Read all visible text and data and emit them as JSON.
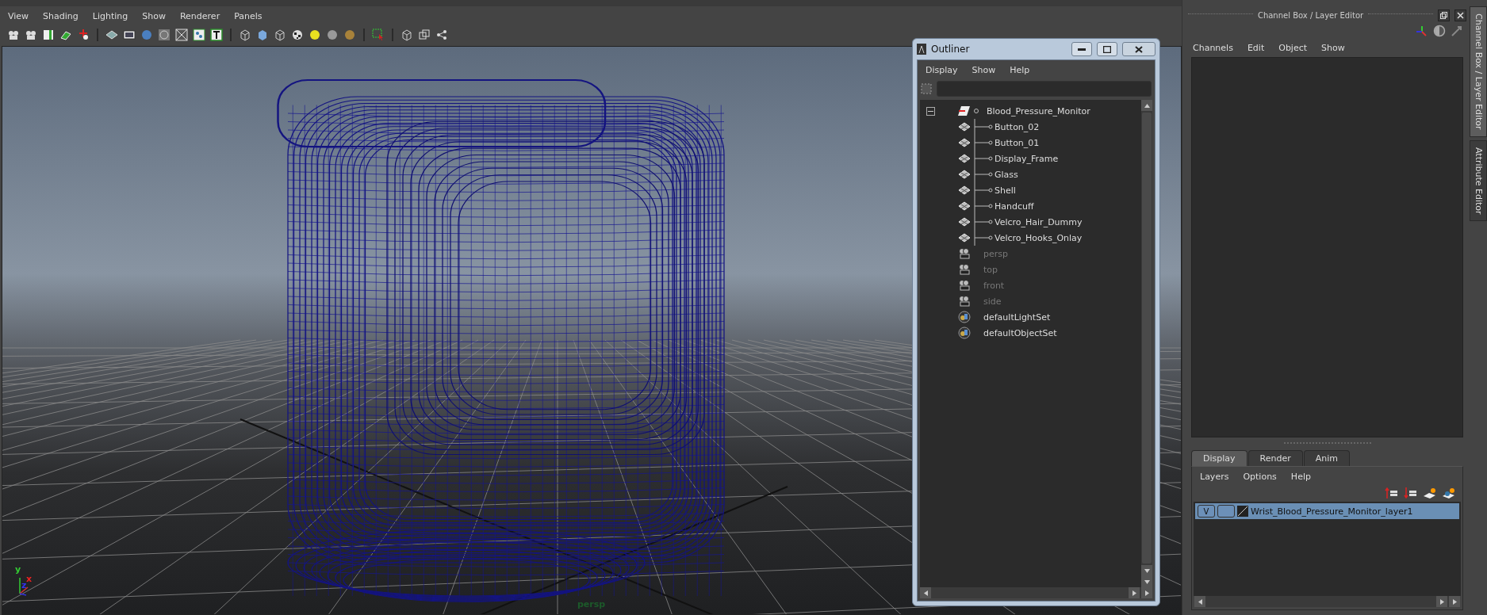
{
  "viewport_menu": [
    "View",
    "Shading",
    "Lighting",
    "Show",
    "Renderer",
    "Panels"
  ],
  "viewport": {
    "camera_label": "persp",
    "axis_labels": [
      "y",
      "x",
      "z"
    ]
  },
  "outliner": {
    "title": "Outliner",
    "menu": [
      "Display",
      "Show",
      "Help"
    ],
    "items": [
      {
        "label": "Blood_Pressure_Monitor",
        "kind": "group",
        "expanded": true,
        "children": [
          {
            "label": "Button_02",
            "kind": "mesh"
          },
          {
            "label": "Button_01",
            "kind": "mesh"
          },
          {
            "label": "Display_Frame",
            "kind": "mesh"
          },
          {
            "label": "Glass",
            "kind": "mesh"
          },
          {
            "label": "Shell",
            "kind": "mesh"
          },
          {
            "label": "Handcuff",
            "kind": "mesh"
          },
          {
            "label": "Velcro_Hair_Dummy",
            "kind": "mesh"
          },
          {
            "label": "Velcro_Hooks_Onlay",
            "kind": "mesh"
          }
        ]
      },
      {
        "label": "persp",
        "kind": "camera"
      },
      {
        "label": "top",
        "kind": "camera"
      },
      {
        "label": "front",
        "kind": "camera"
      },
      {
        "label": "side",
        "kind": "camera"
      },
      {
        "label": "defaultLightSet",
        "kind": "set"
      },
      {
        "label": "defaultObjectSet",
        "kind": "set"
      }
    ]
  },
  "channel_box": {
    "title": "Channel Box / Layer Editor",
    "menu": [
      "Channels",
      "Edit",
      "Object",
      "Show"
    ]
  },
  "layer_editor": {
    "tabs": [
      {
        "label": "Display",
        "selected": true
      },
      {
        "label": "Render",
        "selected": false
      },
      {
        "label": "Anim",
        "selected": false
      }
    ],
    "menu": [
      "Layers",
      "Options",
      "Help"
    ],
    "layers": [
      {
        "visibility": "V",
        "name": "Wrist_Blood_Pressure_Monitor_layer1",
        "selected": true
      }
    ]
  },
  "side_tabs": [
    {
      "label": "Channel Box / Layer Editor",
      "selected": true
    },
    {
      "label": "Attribute Editor",
      "selected": false
    }
  ]
}
